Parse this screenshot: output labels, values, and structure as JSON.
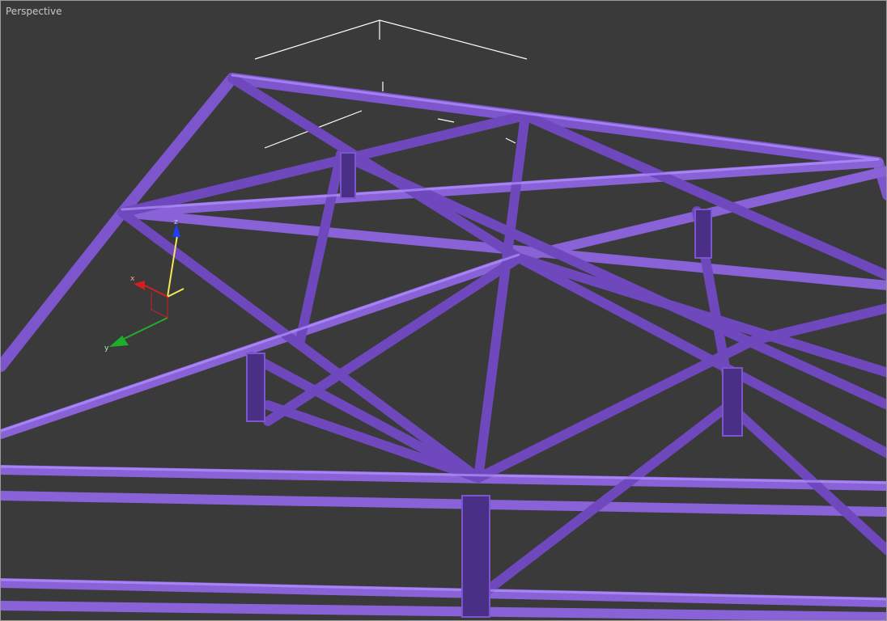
{
  "viewport": {
    "label": "Perspective",
    "background": "#3a3a3a"
  },
  "scene": {
    "object_color": "#7d55cc",
    "object_dark": "#4a2f86",
    "object_light": "#a07ff0",
    "selection_bracket_color": "#ffffff"
  },
  "gizmo": {
    "axis_z_label": "z",
    "axis_x_label": "x",
    "axis_y_label": "y",
    "z_color": "#1f3dff",
    "x_color": "#d21f1f",
    "y_color": "#1fae2a",
    "shaft_color": "#f2e85a"
  }
}
